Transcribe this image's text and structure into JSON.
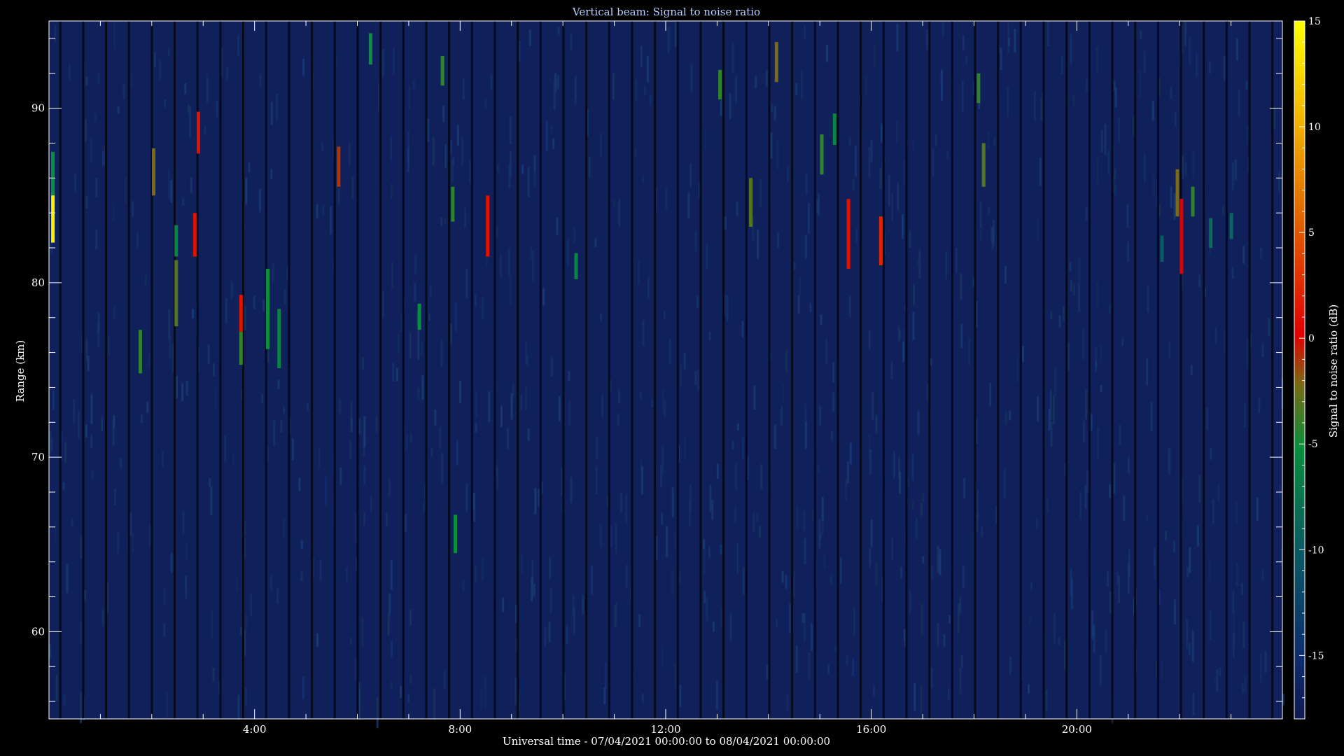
{
  "chart_data": {
    "type": "heatmap",
    "title": "Vertical beam: Signal to noise ratio",
    "xlabel": "Universal time - 07/04/2021 00:00:00 to 08/04/2021 00:00:00",
    "ylabel": "Range (km)",
    "colorbar_label": "Signal to noise ratio (dB)",
    "xlim_hours": [
      0,
      24
    ],
    "ylim_km": [
      55,
      95
    ],
    "clim_db": [
      -18,
      15
    ],
    "x_ticks": [
      {
        "value": 4,
        "label": "4:00"
      },
      {
        "value": 8,
        "label": "8:00"
      },
      {
        "value": 12,
        "label": "12:00"
      },
      {
        "value": 16,
        "label": "16:00"
      },
      {
        "value": 20,
        "label": "20:00"
      }
    ],
    "y_ticks": [
      {
        "value": 60,
        "label": "60"
      },
      {
        "value": 70,
        "label": "70"
      },
      {
        "value": 80,
        "label": "80"
      },
      {
        "value": 90,
        "label": "90"
      }
    ],
    "colorbar_ticks": [
      {
        "value": 15,
        "label": "15"
      },
      {
        "value": 10,
        "label": "10"
      },
      {
        "value": 5,
        "label": "5"
      },
      {
        "value": 0,
        "label": "0"
      },
      {
        "value": -5,
        "label": "-5"
      },
      {
        "value": -10,
        "label": "-10"
      },
      {
        "value": -15,
        "label": "-15"
      }
    ],
    "background_db": -17,
    "echoes": [
      {
        "t": 0.07,
        "r0": 82.3,
        "r1": 85.2,
        "db": 14
      },
      {
        "t": 0.07,
        "r0": 85.0,
        "r1": 87.5,
        "db": -5
      },
      {
        "t": 1.77,
        "r0": 74.8,
        "r1": 77.3,
        "db": -4
      },
      {
        "t": 2.03,
        "r0": 85.0,
        "r1": 87.7,
        "db": -2
      },
      {
        "t": 2.47,
        "r0": 77.5,
        "r1": 81.3,
        "db": -3
      },
      {
        "t": 2.47,
        "r0": 81.5,
        "r1": 83.3,
        "db": -6
      },
      {
        "t": 2.83,
        "r0": 81.5,
        "r1": 84.0,
        "db": 1
      },
      {
        "t": 2.9,
        "r0": 87.4,
        "r1": 89.8,
        "db": 1
      },
      {
        "t": 3.73,
        "r0": 75.3,
        "r1": 77.2,
        "db": -4
      },
      {
        "t": 3.73,
        "r0": 77.2,
        "r1": 79.3,
        "db": 1
      },
      {
        "t": 4.25,
        "r0": 76.2,
        "r1": 80.8,
        "db": -5
      },
      {
        "t": 4.47,
        "r0": 75.1,
        "r1": 78.5,
        "db": -6
      },
      {
        "t": 5.63,
        "r0": 85.5,
        "r1": 87.8,
        "db": -1
      },
      {
        "t": 6.25,
        "r0": 92.5,
        "r1": 94.3,
        "db": -5
      },
      {
        "t": 7.2,
        "r0": 77.3,
        "r1": 78.8,
        "db": -5
      },
      {
        "t": 7.65,
        "r0": 91.3,
        "r1": 93.0,
        "db": -4
      },
      {
        "t": 7.85,
        "r0": 83.5,
        "r1": 85.5,
        "db": -4
      },
      {
        "t": 7.9,
        "r0": 64.5,
        "r1": 66.7,
        "db": -5
      },
      {
        "t": 8.53,
        "r0": 81.5,
        "r1": 85.0,
        "db": 1
      },
      {
        "t": 10.25,
        "r0": 80.2,
        "r1": 81.7,
        "db": -6
      },
      {
        "t": 13.05,
        "r0": 90.5,
        "r1": 92.2,
        "db": -4
      },
      {
        "t": 13.65,
        "r0": 83.2,
        "r1": 86.0,
        "db": -3
      },
      {
        "t": 14.15,
        "r0": 91.5,
        "r1": 93.8,
        "db": -2
      },
      {
        "t": 15.03,
        "r0": 86.2,
        "r1": 88.5,
        "db": -4
      },
      {
        "t": 15.28,
        "r0": 87.9,
        "r1": 89.7,
        "db": -6
      },
      {
        "t": 15.55,
        "r0": 80.8,
        "r1": 84.8,
        "db": 1
      },
      {
        "t": 16.18,
        "r0": 81.0,
        "r1": 83.8,
        "db": 2
      },
      {
        "t": 18.08,
        "r0": 90.3,
        "r1": 92.0,
        "db": -4
      },
      {
        "t": 18.18,
        "r0": 85.5,
        "r1": 88.0,
        "db": -3
      },
      {
        "t": 21.95,
        "r0": 83.8,
        "r1": 86.5,
        "db": -2
      },
      {
        "t": 22.03,
        "r0": 80.5,
        "r1": 84.8,
        "db": 0
      },
      {
        "t": 22.25,
        "r0": 83.8,
        "r1": 85.5,
        "db": -4
      },
      {
        "t": 21.65,
        "r0": 81.2,
        "r1": 82.7,
        "db": -10
      },
      {
        "t": 22.6,
        "r0": 82.0,
        "r1": 83.7,
        "db": -8
      },
      {
        "t": 23.0,
        "r0": 82.5,
        "r1": 84.0,
        "db": -9
      }
    ]
  }
}
